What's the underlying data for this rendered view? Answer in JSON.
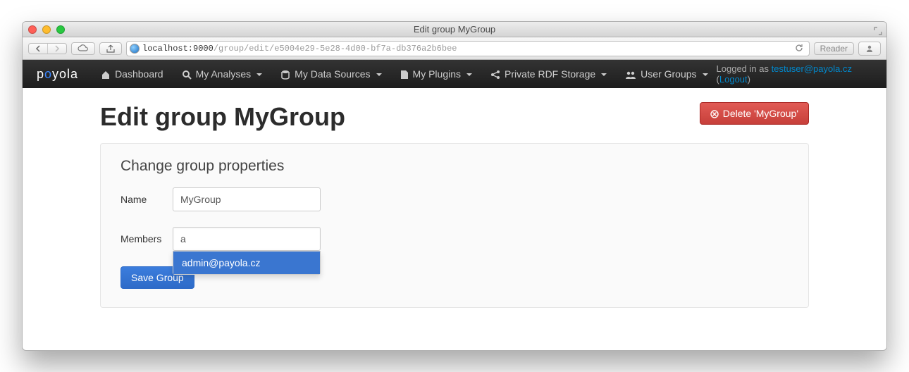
{
  "window": {
    "title": "Edit group MyGroup"
  },
  "url": {
    "host": "localhost:9000",
    "path": "/group/edit/e5004e29-5e28-4d00-bf7a-db376a2b6bee",
    "reader_label": "Reader"
  },
  "brand": {
    "pre": "p",
    "o": "o",
    "post": "yola"
  },
  "nav": {
    "items": [
      {
        "label": "Dashboard"
      },
      {
        "label": "My Analyses"
      },
      {
        "label": "My Data Sources"
      },
      {
        "label": "My Plugins"
      },
      {
        "label": "Private RDF Storage"
      },
      {
        "label": "User Groups"
      }
    ],
    "right": {
      "prefix": "Logged in as ",
      "user": "testuser@payola.cz",
      "paren_open": " (",
      "logout": "Logout",
      "paren_close": ")"
    }
  },
  "heading": "Edit group MyGroup",
  "delete_btn": "Delete 'MyGroup'",
  "panel": {
    "title": "Change group properties",
    "name_label": "Name",
    "name_value": "MyGroup",
    "members_label": "Members",
    "members_value": "a",
    "suggestion": "admin@payola.cz",
    "save_label": "Save Group"
  }
}
